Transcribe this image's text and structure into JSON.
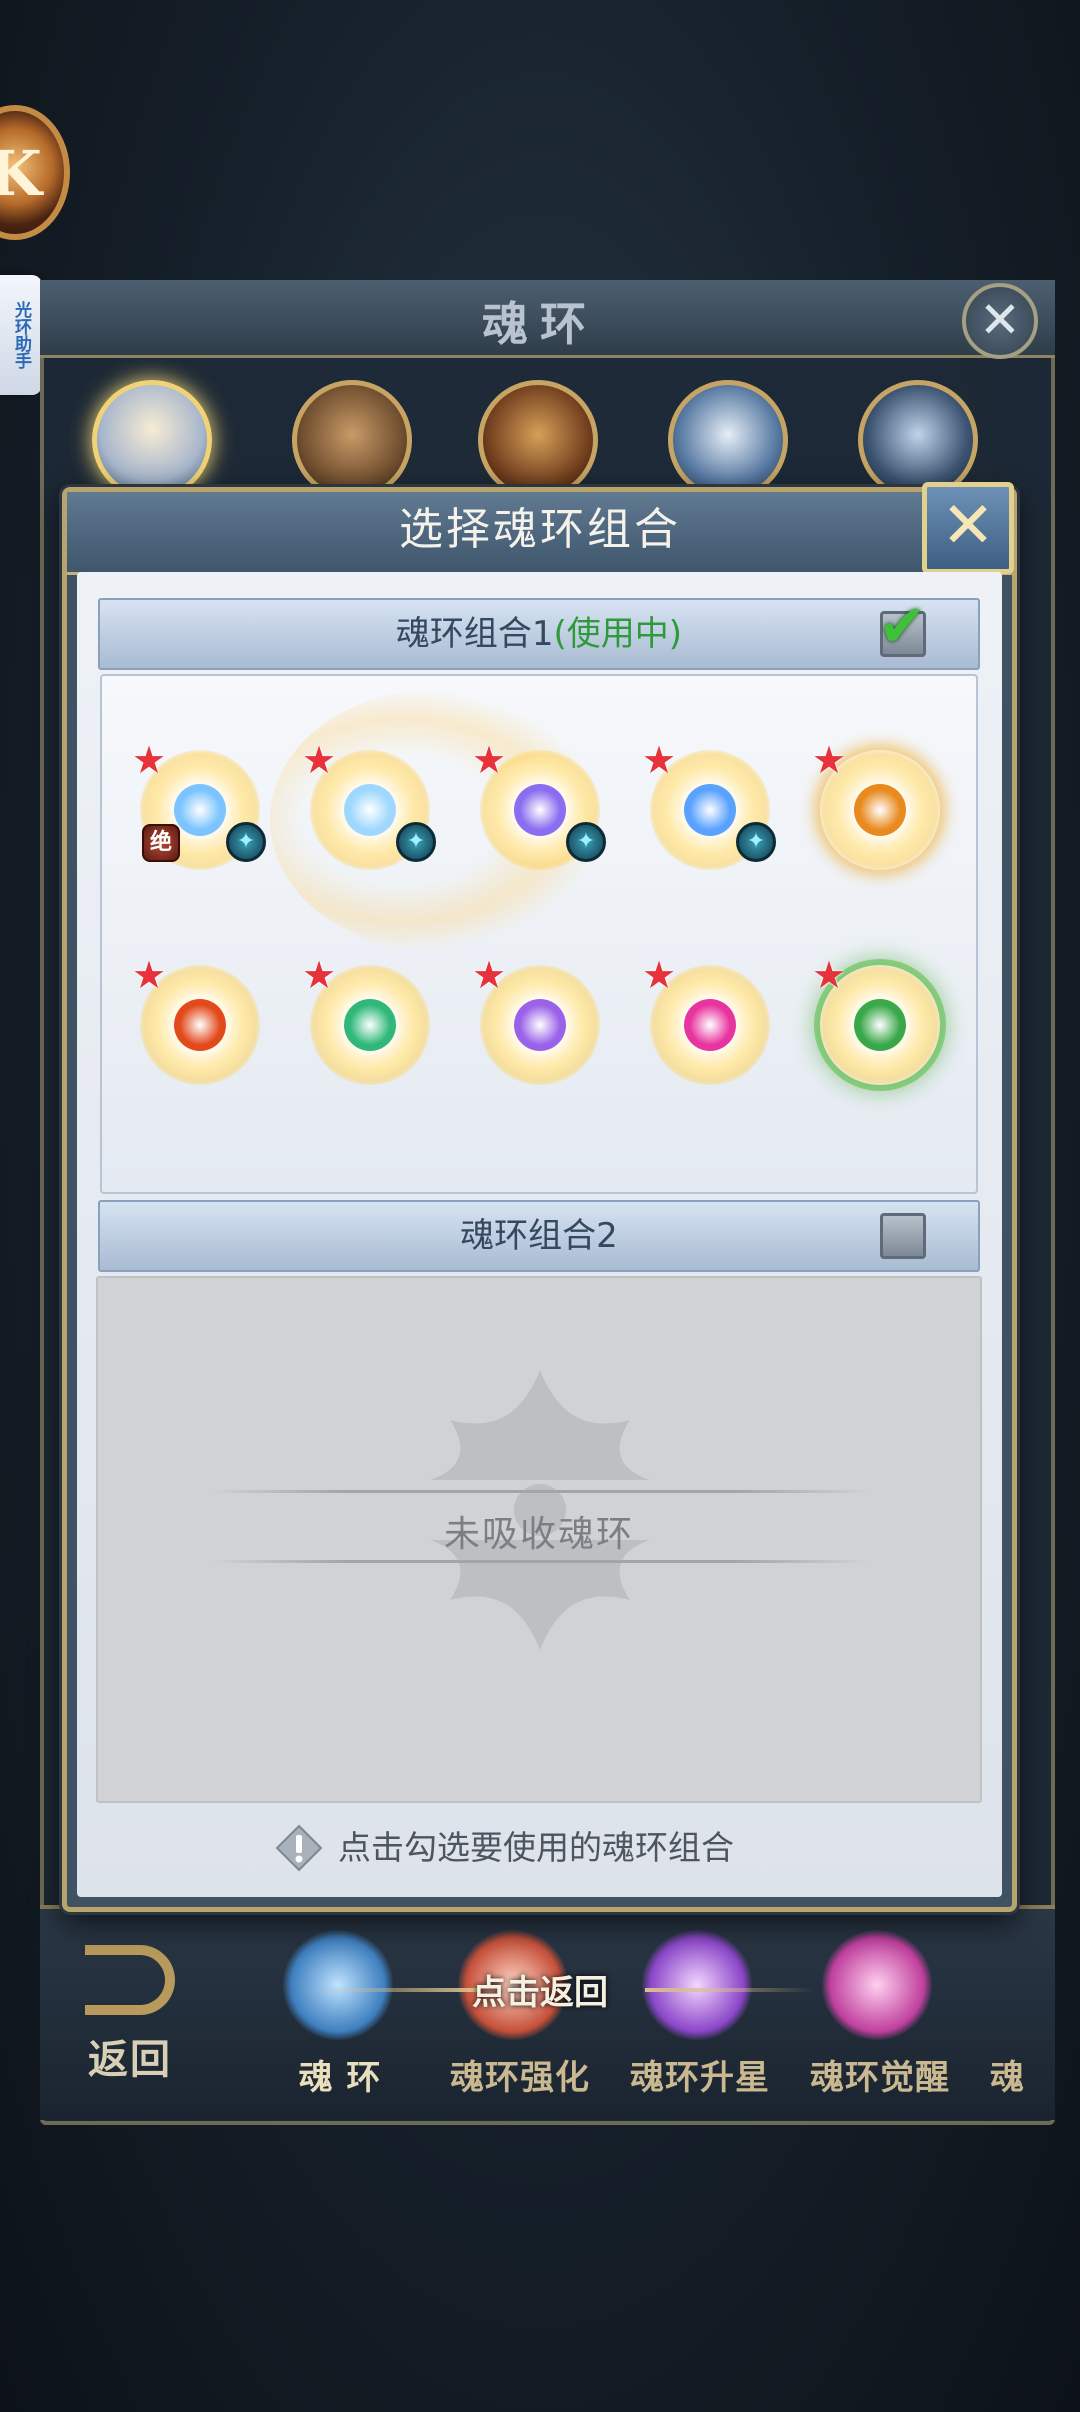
{
  "background": {
    "panel_title": "魂环",
    "side_helper_text": "光环助手",
    "back_label": "返回",
    "tap_return": "点击返回",
    "tabs": [
      {
        "label": "魂  环"
      },
      {
        "label": "魂环强化"
      },
      {
        "label": "魂环升星"
      },
      {
        "label": "魂环觉醒"
      },
      {
        "label": "魂"
      }
    ]
  },
  "dialog": {
    "title": "选择魂环组合",
    "groups": [
      {
        "label": "魂环组合1",
        "status": "(使用中)",
        "checked": true,
        "rings": [
          {
            "icon": "ice-crossbow-ring-icon",
            "core_color": "#7cc4ff",
            "star": "★",
            "badge_left": "绝",
            "badge_right": "✦"
          },
          {
            "icon": "snowflake-ring-icon",
            "core_color": "#9fd8ff",
            "star": "★",
            "badge_right": "✦"
          },
          {
            "icon": "purple-burst-ring-icon",
            "core_color": "#8a6df0",
            "star": "★",
            "badge_right": "✦"
          },
          {
            "icon": "blue-flame-ring-icon",
            "core_color": "#5aa2ff",
            "star": "★",
            "badge_right": "✦"
          },
          {
            "icon": "golden-dragon-ring-icon",
            "core_color": "#e88a1e",
            "star": "★"
          },
          {
            "icon": "fire-ring-icon",
            "core_color": "#e24a1c",
            "star": "★"
          },
          {
            "icon": "green-wings-ring-icon",
            "core_color": "#2fb87a",
            "star": "★"
          },
          {
            "icon": "lightning-ring-icon",
            "core_color": "#9a62e8",
            "star": "★"
          },
          {
            "icon": "pink-crystal-ring-icon",
            "core_color": "#e8349e",
            "star": "★"
          },
          {
            "icon": "green-leaf-ring-icon",
            "core_color": "#3aa84a",
            "star": "★"
          }
        ]
      },
      {
        "label": "魂环组合2",
        "checked": false,
        "empty_text": "未吸收魂环"
      }
    ],
    "hint": "点击勾选要使用的魂环组合"
  },
  "colors": {
    "in_use": "#2e9a3a",
    "star": "#e8323b",
    "dialog_border": "#b9a46b"
  }
}
